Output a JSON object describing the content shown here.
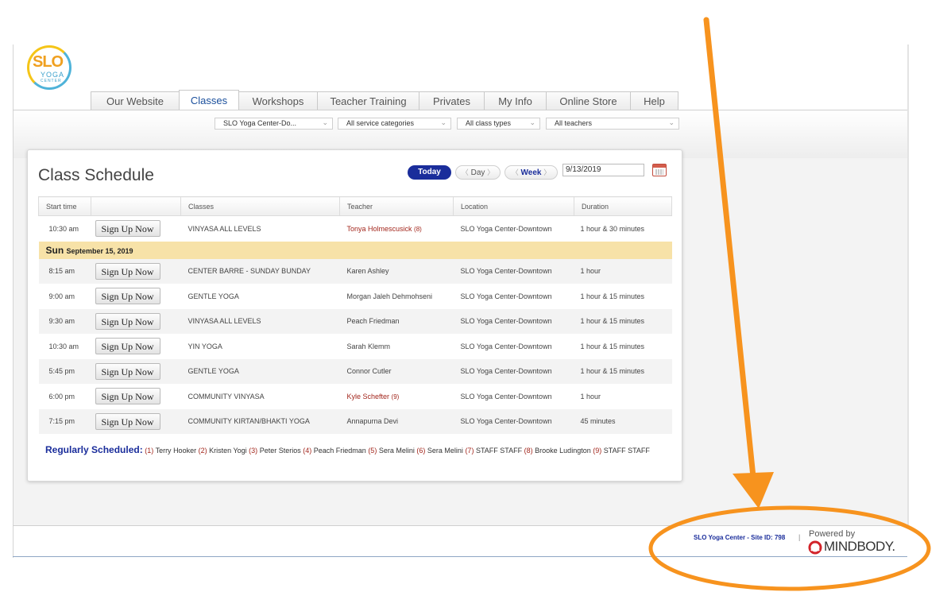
{
  "logo": {
    "primary": "SLO",
    "secondary": "YOGA",
    "tertiary": "CENTER"
  },
  "tabs": [
    {
      "label": "Our Website",
      "active": false
    },
    {
      "label": "Classes",
      "active": true
    },
    {
      "label": "Workshops",
      "active": false
    },
    {
      "label": "Teacher Training",
      "active": false
    },
    {
      "label": "Privates",
      "active": false
    },
    {
      "label": "My Info",
      "active": false
    },
    {
      "label": "Online Store",
      "active": false
    },
    {
      "label": "Help",
      "active": false
    }
  ],
  "filters": {
    "location": "SLO Yoga Center-Do...",
    "service_category": "All service categories",
    "class_type": "All class types",
    "teacher": "All teachers"
  },
  "schedule": {
    "title": "Class Schedule",
    "today_label": "Today",
    "day_label": "Day",
    "week_label": "Week",
    "date_value": "9/13/2019",
    "columns": [
      "Start time",
      "",
      "Classes",
      "Teacher",
      "Location",
      "Duration"
    ],
    "signup_label": "Sign Up Now",
    "first_row": {
      "time": "10:30 am",
      "class": "VINYASA ALL LEVELS",
      "teacher": "Tonya Holmescusick",
      "count": "(8)",
      "location": "SLO Yoga Center-Downtown",
      "duration": "1 hour & 30 minutes"
    },
    "day_header": {
      "day": "Sun",
      "date": "September 15, 2019"
    },
    "rows": [
      {
        "time": "8:15 am",
        "class": "CENTER BARRE - SUNDAY BUNDAY",
        "teacher": "Karen Ashley",
        "count": "",
        "location": "SLO Yoga Center-Downtown",
        "duration": "1 hour"
      },
      {
        "time": "9:00 am",
        "class": "GENTLE YOGA",
        "teacher": "Morgan Jaleh Dehmohseni",
        "count": "",
        "location": "SLO Yoga Center-Downtown",
        "duration": "1 hour & 15 minutes"
      },
      {
        "time": "9:30 am",
        "class": "VINYASA ALL LEVELS",
        "teacher": "Peach Friedman",
        "count": "",
        "location": "SLO Yoga Center-Downtown",
        "duration": "1 hour & 15 minutes"
      },
      {
        "time": "10:30 am",
        "class": "YIN YOGA",
        "teacher": "Sarah Klemm",
        "count": "",
        "location": "SLO Yoga Center-Downtown",
        "duration": "1 hour & 15 minutes"
      },
      {
        "time": "5:45 pm",
        "class": "GENTLE YOGA",
        "teacher": "Connor Cutler",
        "count": "",
        "location": "SLO Yoga Center-Downtown",
        "duration": "1 hour & 15 minutes"
      },
      {
        "time": "6:00 pm",
        "class": "COMMUNITY VINYASA",
        "teacher": "Kyle Schefter",
        "count": "(9)",
        "location": "SLO Yoga Center-Downtown",
        "duration": "1 hour"
      },
      {
        "time": "7:15 pm",
        "class": "COMMUNITY KIRTAN/BHAKTI YOGA",
        "teacher": "Annapurna Devi",
        "count": "",
        "location": "SLO Yoga Center-Downtown",
        "duration": "45 minutes"
      }
    ],
    "regular_label": "Regularly Scheduled:",
    "regular_list": [
      {
        "num": "(1)",
        "name": "Terry Hooker"
      },
      {
        "num": "(2)",
        "name": "Kristen Yogi"
      },
      {
        "num": "(3)",
        "name": "Peter Sterios"
      },
      {
        "num": "(4)",
        "name": "Peach Friedman"
      },
      {
        "num": "(5)",
        "name": "Sera Melini"
      },
      {
        "num": "(6)",
        "name": "Sera Melini"
      },
      {
        "num": "(7)",
        "name": "STAFF STAFF"
      },
      {
        "num": "(8)",
        "name": "Brooke Ludington"
      },
      {
        "num": "(9)",
        "name": "STAFF STAFF"
      }
    ]
  },
  "footer": {
    "site_text": "SLO Yoga Center - Site ID: 798",
    "separator": "|",
    "powered_by": "Powered by",
    "brand": "MINDBODY."
  },
  "colors": {
    "accent_blue": "#1a2d9b",
    "teacher_sub_red": "#a3271d",
    "day_band": "#f7e2a8",
    "annotation_orange": "#f7931e"
  }
}
